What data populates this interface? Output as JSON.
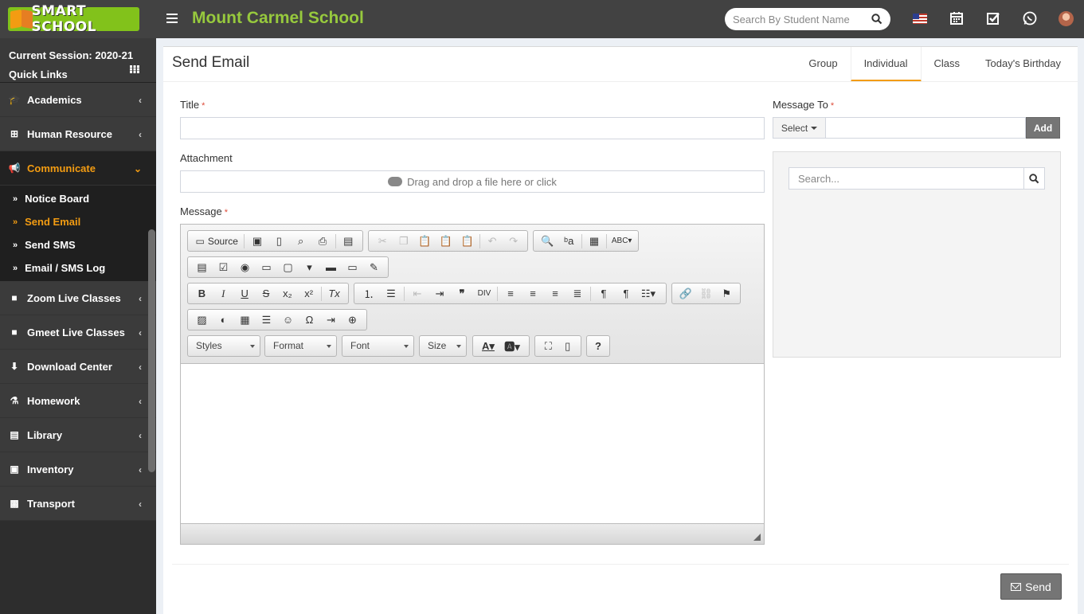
{
  "header": {
    "logo_text": "SMART SCHOOL",
    "school_name": "Mount Carmel School",
    "search_placeholder": "Search By Student Name"
  },
  "sidebar": {
    "session_label": "Current Session: 2020-21",
    "quick_links": "Quick Links",
    "items": [
      {
        "label": "Academics",
        "icon": "graduation-cap-icon"
      },
      {
        "label": "Human Resource",
        "icon": "sitemap-icon"
      },
      {
        "label": "Communicate",
        "icon": "bullhorn-icon",
        "active": true
      },
      {
        "label": "Zoom Live Classes",
        "icon": "video-camera-icon"
      },
      {
        "label": "Gmeet Live Classes",
        "icon": "video-camera-icon"
      },
      {
        "label": "Download Center",
        "icon": "download-icon"
      },
      {
        "label": "Homework",
        "icon": "flask-icon"
      },
      {
        "label": "Library",
        "icon": "book-icon"
      },
      {
        "label": "Inventory",
        "icon": "inventory-icon"
      },
      {
        "label": "Transport",
        "icon": "bus-icon"
      }
    ],
    "subitems": [
      {
        "label": "Notice Board"
      },
      {
        "label": "Send Email",
        "active": true
      },
      {
        "label": "Send SMS"
      },
      {
        "label": "Email / SMS Log"
      }
    ]
  },
  "page": {
    "title": "Send Email",
    "tabs": [
      "Group",
      "Individual",
      "Class",
      "Today's Birthday"
    ],
    "active_tab": "Individual"
  },
  "form": {
    "title_label": "Title",
    "attachment_label": "Attachment",
    "dropzone_text": "Drag and drop a file here or click",
    "message_label": "Message",
    "required_mark": "*",
    "message_to_label": "Message To",
    "select_label": "Select",
    "add_label": "Add",
    "search_placeholder": "Search...",
    "send_label": "Send"
  },
  "editor": {
    "source_label": "Source",
    "combos": [
      "Styles",
      "Format",
      "Font",
      "Size"
    ]
  },
  "colors": {
    "accent": "#f39c12",
    "brand_green": "#97c93d",
    "header_bg": "#424242",
    "sidebar_bg": "#2d2d2d"
  }
}
